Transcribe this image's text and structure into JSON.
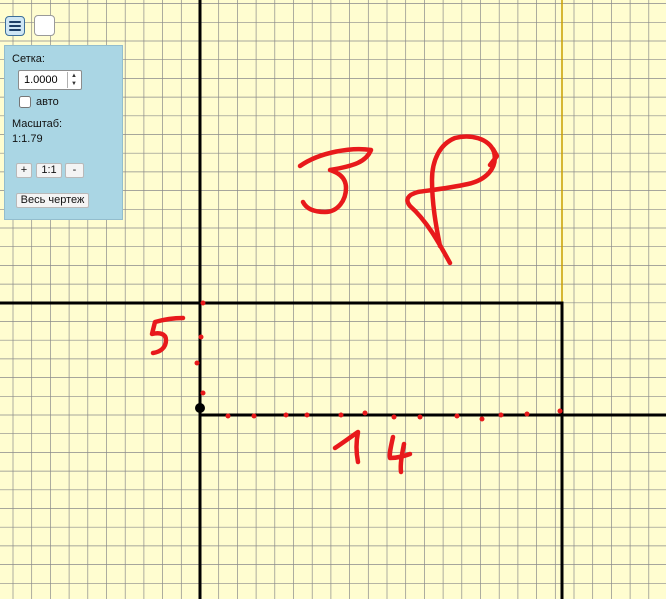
{
  "toolbar": {
    "menu_icon": "hamburger-menu-icon",
    "blank_icon": "empty-square-icon"
  },
  "panel": {
    "grid_label": "Сетка:",
    "grid_value": "1.0000",
    "auto_label": "авто",
    "auto_checked": false,
    "scale_label": "Масштаб:",
    "scale_value": "1:1.79",
    "zoom_in_label": "+",
    "zoom_reset_label": "1:1",
    "zoom_out_label": "-",
    "fit_all_label": "Весь чертеж"
  },
  "drawing": {
    "grid_step": 1,
    "background_color": "#fffdd0",
    "grid_color": "#8a8a8a",
    "line_color": "#000000",
    "annotation_color": "#e8191b",
    "annotation_texts": [
      "38",
      "5",
      "14"
    ]
  }
}
